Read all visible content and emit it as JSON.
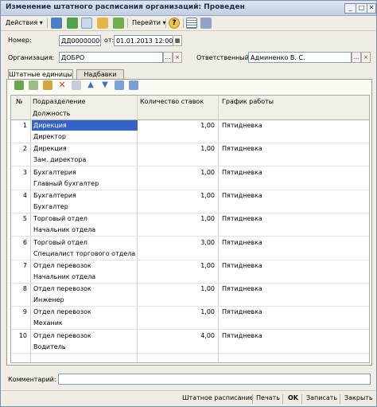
{
  "window": {
    "title": "Изменение штатного расписания организаций: Проведен",
    "minimize": "_",
    "maximize": "□",
    "close": "✕"
  },
  "toolbar": {
    "actions_label": "Действия ▾",
    "goto_label": "Перейти ▾",
    "help_label": "?"
  },
  "header": {
    "number_label": "Номер:",
    "number_value": "ДД00000000",
    "date_label": "от:",
    "date_value": "01.01.2013 12:00:00",
    "org_label": "Организация:",
    "org_value": "ДОБРО",
    "resp_label": "Ответственный:",
    "resp_value": "Админенко В. С.",
    "btn_select": "...",
    "btn_clear": "×",
    "btn_cal": "▦"
  },
  "tabs": [
    {
      "label": "Штатные единицы"
    },
    {
      "label": "Надбавки"
    }
  ],
  "grid": {
    "columns": {
      "num": "№",
      "dept": "Подразделение",
      "position": "Должность",
      "rate": "Количество ставок",
      "schedule": "График работы"
    },
    "rows": [
      {
        "n": "1",
        "dept": "Дирекция",
        "position": "Директор",
        "rate": "1,00",
        "schedule": "Пятидневка"
      },
      {
        "n": "2",
        "dept": "Дирекция",
        "position": "Зам. директора",
        "rate": "1,00",
        "schedule": "Пятидневка"
      },
      {
        "n": "3",
        "dept": "Бухгалтерия",
        "position": "Главный бухгалтер",
        "rate": "1,00",
        "schedule": "Пятидневка"
      },
      {
        "n": "4",
        "dept": "Бухгалтерия",
        "position": "Бухгалтер",
        "rate": "1,00",
        "schedule": "Пятидневка"
      },
      {
        "n": "5",
        "dept": "Торговый отдел",
        "position": "Начальник отдела",
        "rate": "1,00",
        "schedule": "Пятидневка"
      },
      {
        "n": "6",
        "dept": "Торговый отдел",
        "position": "Специалист торгового отдела",
        "rate": "3,00",
        "schedule": "Пятидневка"
      },
      {
        "n": "7",
        "dept": "Отдел перевозок",
        "position": "Начальник отдела",
        "rate": "1,00",
        "schedule": "Пятидневка"
      },
      {
        "n": "8",
        "dept": "Отдел перевозок",
        "position": "Инженер",
        "rate": "1,00",
        "schedule": "Пятидневка"
      },
      {
        "n": "9",
        "dept": "Отдел перевозок",
        "position": "Механик",
        "rate": "1,00",
        "schedule": "Пятидневка"
      },
      {
        "n": "10",
        "dept": "Отдел перевозок",
        "position": "Водитель",
        "rate": "4,00",
        "schedule": "Пятидневка"
      }
    ]
  },
  "comment": {
    "label": "Комментарий:",
    "value": ""
  },
  "footer": {
    "staffing_label": "Штатное расписание",
    "print_label": "Печать",
    "ok_label": "OK",
    "save_label": "Записать",
    "close_label": "Закрыть"
  }
}
